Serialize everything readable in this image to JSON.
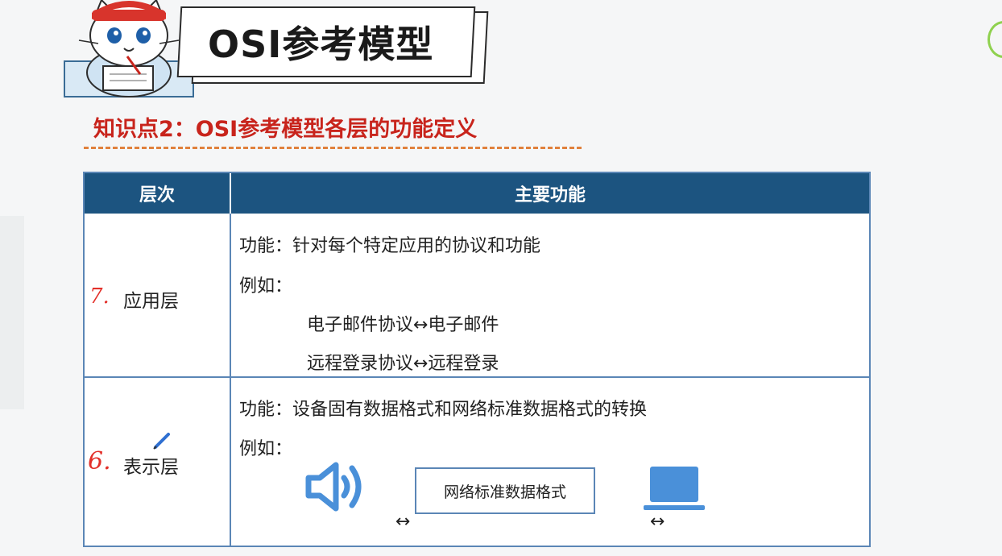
{
  "banner": {
    "title": "OSI参考模型"
  },
  "knowledge_point": "知识点2：OSI参考模型各层的功能定义",
  "table": {
    "headers": {
      "layer": "层次",
      "function": "主要功能"
    },
    "rows": [
      {
        "number": "7.",
        "name": "应用层",
        "function": "功能：针对每个特定应用的协议和功能",
        "example_label": "例如：",
        "examples": [
          "电子邮件协议↔电子邮件",
          "远程登录协议↔远程登录"
        ]
      },
      {
        "number": "6.",
        "name": "表示层",
        "function": "功能：设备固有数据格式和网络标准数据格式的转换",
        "example_label": "例如：",
        "box_text": "网络标准数据格式",
        "arrow": "↔"
      }
    ]
  },
  "colors": {
    "header_bg": "#1c5480",
    "border": "#5b86b6",
    "subtitle": "#c8241c",
    "dash": "#e0813c",
    "icon_blue": "#4a90d9"
  },
  "icons": [
    "mascot-cat",
    "pencil-icon",
    "speaker-icon",
    "laptop-icon"
  ]
}
